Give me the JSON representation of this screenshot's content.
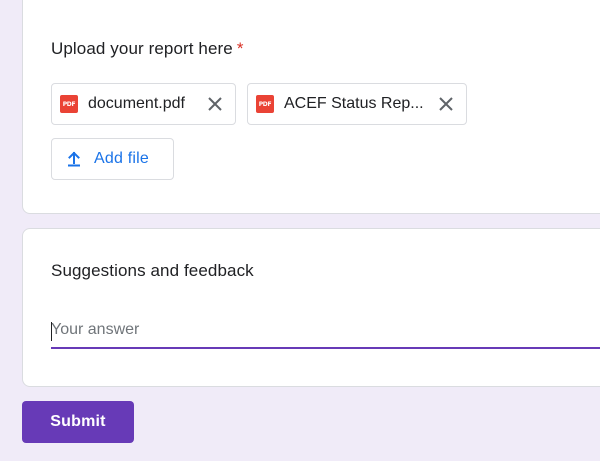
{
  "upload_question": {
    "title": "Upload your report here",
    "required_mark": "*",
    "files": [
      {
        "name": "document.pdf",
        "icon": "pdf-icon",
        "icon_text": "PDF"
      },
      {
        "name": "ACEF Status Rep...",
        "icon": "pdf-icon",
        "icon_text": "PDF"
      }
    ],
    "add_file_label": "Add file"
  },
  "feedback_question": {
    "title": "Suggestions and feedback",
    "placeholder": "Your answer",
    "value": ""
  },
  "submit_label": "Submit",
  "colors": {
    "background": "#f0ebf8",
    "accent": "#673ab7",
    "link_blue": "#1a73e8",
    "required_red": "#d93025",
    "pdf_red": "#ea4335"
  }
}
